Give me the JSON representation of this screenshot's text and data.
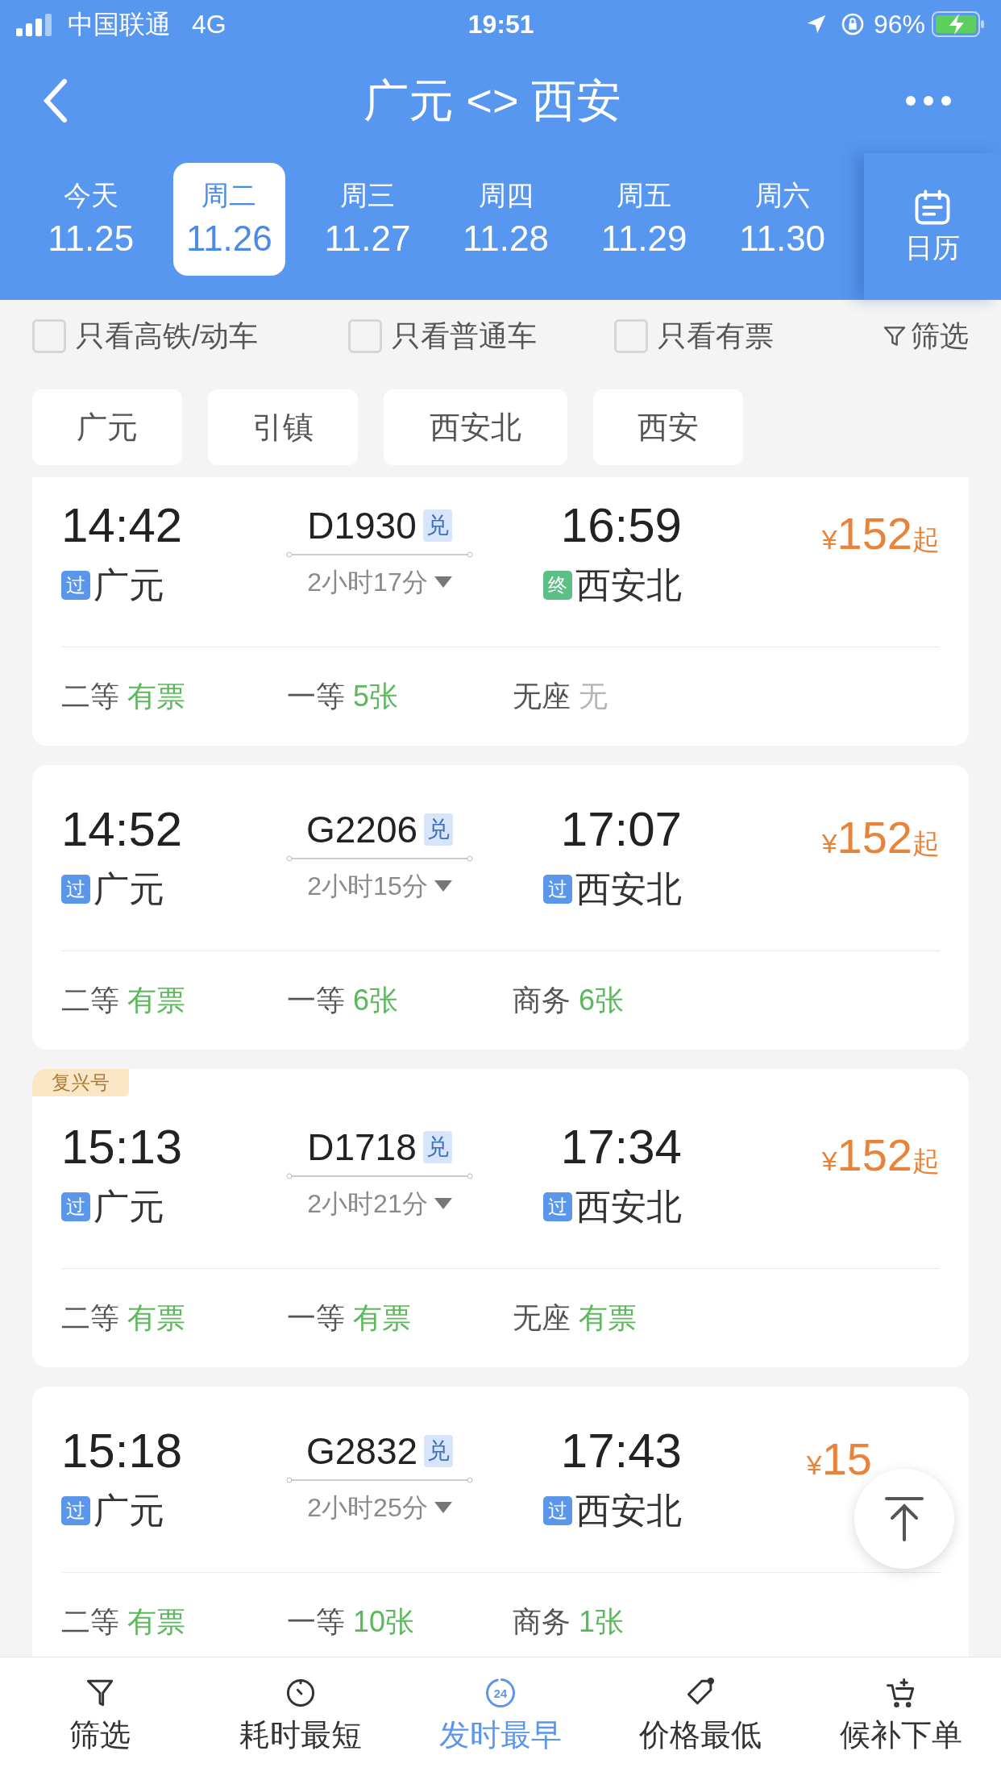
{
  "status_bar": {
    "carrier": "中国联通",
    "network": "4G",
    "time": "19:51",
    "battery": "96%"
  },
  "header": {
    "title": "广元 <> 西安"
  },
  "dates": [
    {
      "weekday": "今天",
      "date": "11.25",
      "selected": false
    },
    {
      "weekday": "周二",
      "date": "11.26",
      "selected": true
    },
    {
      "weekday": "周三",
      "date": "11.27",
      "selected": false
    },
    {
      "weekday": "周四",
      "date": "11.28",
      "selected": false
    },
    {
      "weekday": "周五",
      "date": "11.29",
      "selected": false
    },
    {
      "weekday": "周六",
      "date": "11.30",
      "selected": false
    }
  ],
  "calendar_button": "日历",
  "filters": [
    {
      "label": "只看高铁/动车",
      "checked": false
    },
    {
      "label": "只看普通车",
      "checked": false
    },
    {
      "label": "只看有票",
      "checked": false
    }
  ],
  "filter_button": "筛选",
  "stations": [
    "广元",
    "引镇",
    "西安北",
    "西安"
  ],
  "trains": [
    {
      "depart": "14:42",
      "train_no": "D1930",
      "exchange": "兑",
      "duration": "2小时17分",
      "arrive": "16:59",
      "from_badge": {
        "kind": "pass",
        "text": "过"
      },
      "from": "广元",
      "to_badge": {
        "kind": "terminal",
        "text": "终"
      },
      "to": "西安北",
      "currency": "¥",
      "price": "152",
      "price_suffix": "起",
      "seats": [
        {
          "class": "二等",
          "status": "有票",
          "kind": "available"
        },
        {
          "class": "一等",
          "status": "5张",
          "kind": "available"
        },
        {
          "class": "无座",
          "status": "无",
          "kind": "none"
        }
      ]
    },
    {
      "depart": "14:52",
      "train_no": "G2206",
      "exchange": "兑",
      "duration": "2小时15分",
      "arrive": "17:07",
      "from_badge": {
        "kind": "pass",
        "text": "过"
      },
      "from": "广元",
      "to_badge": {
        "kind": "pass",
        "text": "过"
      },
      "to": "西安北",
      "currency": "¥",
      "price": "152",
      "price_suffix": "起",
      "seats": [
        {
          "class": "二等",
          "status": "有票",
          "kind": "available"
        },
        {
          "class": "一等",
          "status": "6张",
          "kind": "available"
        },
        {
          "class": "商务",
          "status": "6张",
          "kind": "available"
        }
      ]
    },
    {
      "tag": "复兴号",
      "depart": "15:13",
      "train_no": "D1718",
      "exchange": "兑",
      "duration": "2小时21分",
      "arrive": "17:34",
      "from_badge": {
        "kind": "pass",
        "text": "过"
      },
      "from": "广元",
      "to_badge": {
        "kind": "pass",
        "text": "过"
      },
      "to": "西安北",
      "currency": "¥",
      "price": "152",
      "price_suffix": "起",
      "seats": [
        {
          "class": "二等",
          "status": "有票",
          "kind": "available"
        },
        {
          "class": "一等",
          "status": "有票",
          "kind": "available"
        },
        {
          "class": "无座",
          "status": "有票",
          "kind": "available"
        }
      ]
    },
    {
      "depart": "15:18",
      "train_no": "G2832",
      "exchange": "兑",
      "duration": "2小时25分",
      "arrive": "17:43",
      "from_badge": {
        "kind": "pass",
        "text": "过"
      },
      "from": "广元",
      "to_badge": {
        "kind": "pass",
        "text": "过"
      },
      "to": "西安北",
      "currency": "¥",
      "price": "15",
      "seats": [
        {
          "class": "二等",
          "status": "有票",
          "kind": "available"
        },
        {
          "class": "一等",
          "status": "10张",
          "kind": "available"
        },
        {
          "class": "商务",
          "status": "1张",
          "kind": "available"
        }
      ]
    }
  ],
  "bottom_nav": [
    {
      "label": "筛选",
      "kind": "filter",
      "selected": false
    },
    {
      "label": "耗时最短",
      "kind": "timer",
      "selected": false
    },
    {
      "label": "发时最早",
      "kind": "clock",
      "icon_text": "24",
      "selected": true
    },
    {
      "label": "价格最低",
      "kind": "tag",
      "selected": false
    },
    {
      "label": "候补下单",
      "kind": "cart",
      "selected": false
    }
  ]
}
